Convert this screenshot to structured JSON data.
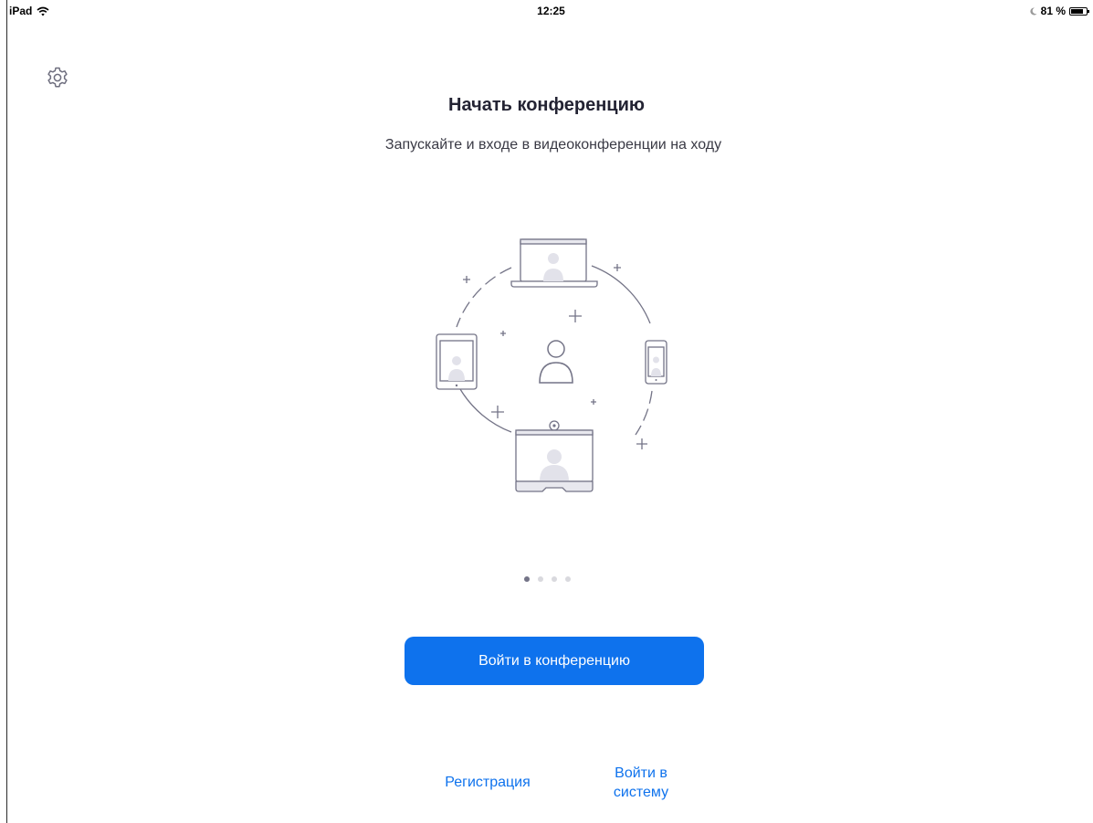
{
  "status_bar": {
    "device": "iPad",
    "time": "12:25",
    "battery_percent": "81 %",
    "battery_level": 0.81
  },
  "icons": {
    "settings": "gear-icon",
    "wifi": "wifi-icon",
    "battery": "battery-icon",
    "moon": "moon-icon"
  },
  "onboarding": {
    "title": "Начать конференцию",
    "subtitle": "Запускайте и входе в видеоконференции на ходу",
    "illustration": "devices-meeting-illustration",
    "pages_total": 4,
    "current_page": 1
  },
  "actions": {
    "join_label": "Войти в конференцию",
    "register_label": "Регистрация",
    "signin_label": "Войти в систему"
  },
  "colors": {
    "accent": "#0e72ed",
    "text": "#232333",
    "dot_active": "#747487",
    "dot_inactive": "#d9d9de"
  }
}
